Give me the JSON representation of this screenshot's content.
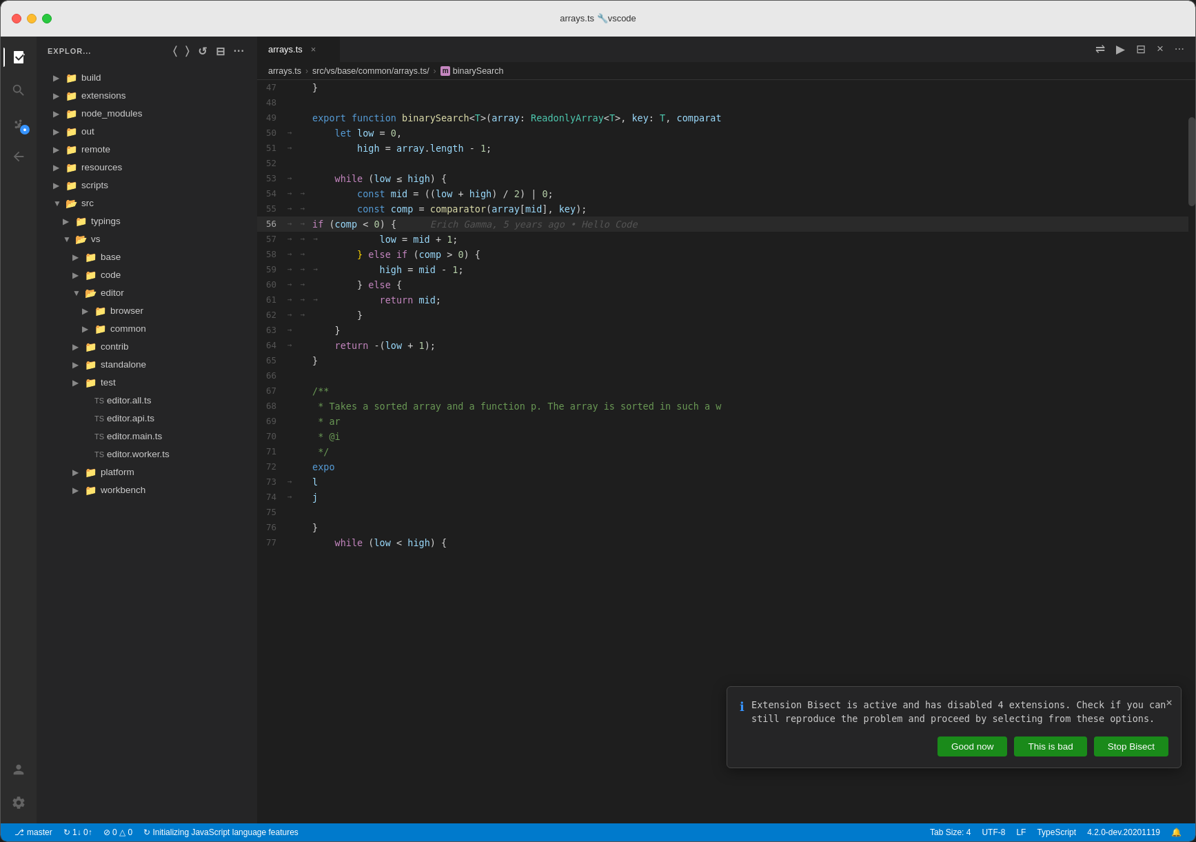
{
  "window": {
    "title": "arrays.ts 🔧vscode"
  },
  "traffic_lights": {
    "red": "close",
    "yellow": "minimize",
    "green": "maximize"
  },
  "sidebar": {
    "header": "EXPLOR...",
    "header_icons": [
      "new-file",
      "new-folder",
      "refresh",
      "collapse",
      "more"
    ],
    "items": [
      {
        "label": "build",
        "indent": 1,
        "type": "folder",
        "open": false
      },
      {
        "label": "extensions",
        "indent": 1,
        "type": "folder",
        "open": false
      },
      {
        "label": "node_modules",
        "indent": 1,
        "type": "folder",
        "open": false
      },
      {
        "label": "out",
        "indent": 1,
        "type": "folder",
        "open": false
      },
      {
        "label": "remote",
        "indent": 1,
        "type": "folder",
        "open": false
      },
      {
        "label": "resources",
        "indent": 1,
        "type": "folder",
        "open": false
      },
      {
        "label": "scripts",
        "indent": 1,
        "type": "folder",
        "open": false
      },
      {
        "label": "src",
        "indent": 1,
        "type": "folder",
        "open": true
      },
      {
        "label": "typings",
        "indent": 2,
        "type": "folder",
        "open": false
      },
      {
        "label": "vs",
        "indent": 2,
        "type": "folder",
        "open": true
      },
      {
        "label": "base",
        "indent": 3,
        "type": "folder",
        "open": false
      },
      {
        "label": "code",
        "indent": 3,
        "type": "folder",
        "open": false
      },
      {
        "label": "editor",
        "indent": 3,
        "type": "folder",
        "open": true
      },
      {
        "label": "browser",
        "indent": 4,
        "type": "folder",
        "open": false
      },
      {
        "label": "common",
        "indent": 4,
        "type": "folder",
        "open": false
      },
      {
        "label": "contrib",
        "indent": 3,
        "type": "folder",
        "open": false
      },
      {
        "label": "standalone",
        "indent": 3,
        "type": "folder",
        "open": false
      },
      {
        "label": "test",
        "indent": 3,
        "type": "folder",
        "open": false
      },
      {
        "label": "editor.all.ts",
        "indent": 4,
        "type": "file"
      },
      {
        "label": "editor.api.ts",
        "indent": 4,
        "type": "file"
      },
      {
        "label": "editor.main.ts",
        "indent": 4,
        "type": "file"
      },
      {
        "label": "editor.worker.ts",
        "indent": 4,
        "type": "file"
      },
      {
        "label": "platform",
        "indent": 3,
        "type": "folder",
        "open": false
      },
      {
        "label": "workbench",
        "indent": 3,
        "type": "folder",
        "open": false
      }
    ]
  },
  "editor": {
    "tab_filename": "arrays.ts",
    "breadcrumb": [
      "arrays.ts",
      "src/vs/base/common/arrays.ts/",
      "binarySearch"
    ],
    "lines": [
      {
        "num": "47",
        "code": "}"
      },
      {
        "num": "48",
        "code": ""
      },
      {
        "num": "49",
        "code": "export function binarySearch<T>(array: ReadonlyArray<T>, key: T, comparat"
      },
      {
        "num": "50",
        "code": "    let low = 0,"
      },
      {
        "num": "51",
        "code": "        high = array.length - 1;"
      },
      {
        "num": "52",
        "code": ""
      },
      {
        "num": "53",
        "code": "    while (low ≤ high) {"
      },
      {
        "num": "54",
        "code": "        const mid = ((low + high) / 2) | 0;"
      },
      {
        "num": "55",
        "code": "        const comp = comparator(array[mid], key);"
      },
      {
        "num": "56",
        "code": "        if (comp < 0) {",
        "ghost": "Erich Gamma, 5 years ago • Hello Code"
      },
      {
        "num": "57",
        "code": "            low = mid + 1;"
      },
      {
        "num": "58",
        "code": "        } else if (comp > 0) {"
      },
      {
        "num": "59",
        "code": "            high = mid - 1;"
      },
      {
        "num": "60",
        "code": "        } else {"
      },
      {
        "num": "61",
        "code": "            return mid;"
      },
      {
        "num": "62",
        "code": "        }"
      },
      {
        "num": "63",
        "code": "    }"
      },
      {
        "num": "64",
        "code": "    return -(low + 1);"
      },
      {
        "num": "65",
        "code": "}"
      },
      {
        "num": "66",
        "code": ""
      },
      {
        "num": "67",
        "code": "/**"
      },
      {
        "num": "68",
        "code": " * Takes a sorted array and a function p. The array is sorted in such a w"
      },
      {
        "num": "69",
        "code": " * ar"
      },
      {
        "num": "70",
        "code": " * @i"
      },
      {
        "num": "71",
        "code": " */"
      },
      {
        "num": "72",
        "code": "expo"
      },
      {
        "num": "73",
        "code": "    l"
      },
      {
        "num": "74",
        "code": "    j"
      },
      {
        "num": "75",
        "code": ""
      },
      {
        "num": "76",
        "code": "}"
      },
      {
        "num": "77",
        "code": "    while (low < high) {"
      }
    ]
  },
  "notification": {
    "icon": "ℹ",
    "message": "Extension Bisect is active and has disabled 4 extensions. Check if you can still reproduce the problem and proceed by selecting from these options.",
    "buttons": [
      {
        "label": "Good now",
        "id": "good-now"
      },
      {
        "label": "This is bad",
        "id": "this-is-bad"
      },
      {
        "label": "Stop Bisect",
        "id": "stop-bisect"
      }
    ],
    "close_label": "×"
  },
  "status_bar": {
    "branch": "master",
    "sync": "↻  1↓  0↑",
    "errors": "⊘ 0  △ 0",
    "initializing": "↻  Initializing JavaScript language features",
    "tab_size": "Tab Size: 4",
    "encoding": "UTF-8",
    "line_ending": "LF",
    "language": "TypeScript",
    "version": "4.2.0-dev.20201119",
    "bell": "🔔"
  }
}
